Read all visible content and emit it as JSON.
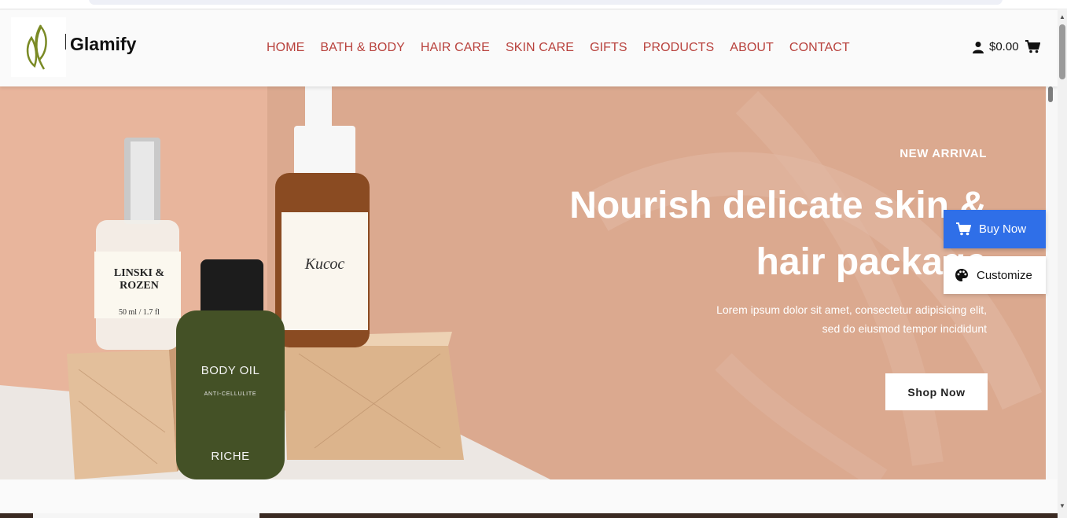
{
  "brand": {
    "name": "Glamify"
  },
  "nav": {
    "items": [
      "HOME",
      "BATH & BODY",
      "HAIR CARE",
      "SKIN CARE",
      "GIFTS",
      "PRODUCTS",
      "ABOUT",
      "CONTACT"
    ]
  },
  "cart": {
    "amount": "$0.00",
    "user_icon": "user-icon",
    "cart_icon": "cart-icon"
  },
  "hero": {
    "eyebrow": "NEW ARRIVAL",
    "headline_line1": "Nourish delicate skin &",
    "headline_line2": "hair package",
    "description_line1": "Lorem ipsum dolor sit amet, consectetur adipisicing elit,",
    "description_line2": "sed do eiusmod tempor incididunt",
    "cta": "Shop Now",
    "product_labels": {
      "jar_brand": "LINSKI & ROZEN",
      "jar_size": "50 ml / 1.7 fl",
      "bottle_label": "Кисос",
      "oil_title": "BODY OIL",
      "oil_sub": "ANTI-CELLULITE",
      "oil_brand": "RICHE"
    }
  },
  "floating": {
    "buy_now": "Buy Now",
    "customize": "Customize"
  },
  "colors": {
    "nav": "#b8413c",
    "hero_bg": "#dba98f",
    "buy_now": "#2f6fe8",
    "logo_leaf": "#7a8a25"
  }
}
